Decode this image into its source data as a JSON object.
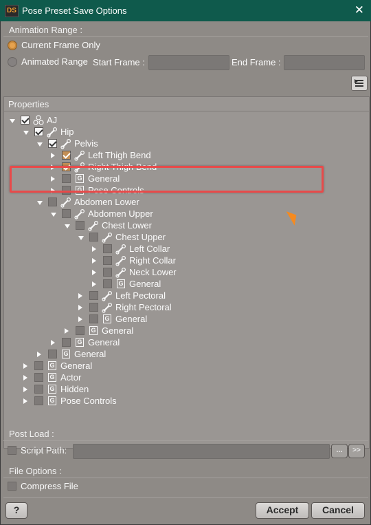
{
  "window": {
    "title": "Pose Preset Save Options",
    "logo": "DS",
    "close": "✕"
  },
  "animation": {
    "section": "Animation Range :",
    "current_frame": "Current Frame Only",
    "animated_range": "Animated Range",
    "start_frame": "Start Frame :",
    "end_frame": "End Frame :"
  },
  "tree": {
    "header": "Properties",
    "rows": [
      {
        "label": "AJ",
        "icon": "figure-icon",
        "checked": "white",
        "arrow": "down"
      },
      {
        "label": "Hip",
        "icon": "bone-icon",
        "checked": "white",
        "arrow": "down"
      },
      {
        "label": "Pelvis",
        "icon": "bone-icon",
        "checked": "white",
        "arrow": "down"
      },
      {
        "label": "Left Thigh Bend",
        "icon": "bone-icon",
        "checked": "orange",
        "arrow": "right"
      },
      {
        "label": "Right Thigh Bend",
        "icon": "bone-icon",
        "checked": "orange",
        "arrow": "right"
      },
      {
        "label": "General",
        "icon": "group-icon",
        "checked": "none",
        "arrow": "right"
      },
      {
        "label": "Pose Controls",
        "icon": "group-icon",
        "checked": "none",
        "arrow": "right"
      },
      {
        "label": "Abdomen Lower",
        "icon": "bone-icon",
        "checked": "none",
        "arrow": "down"
      },
      {
        "label": "Abdomen Upper",
        "icon": "bone-icon",
        "checked": "none",
        "arrow": "down"
      },
      {
        "label": "Chest Lower",
        "icon": "bone-icon",
        "checked": "none",
        "arrow": "down"
      },
      {
        "label": "Chest Upper",
        "icon": "bone-icon",
        "checked": "none",
        "arrow": "down"
      },
      {
        "label": "Left Collar",
        "icon": "bone-icon",
        "checked": "none",
        "arrow": "right"
      },
      {
        "label": "Right Collar",
        "icon": "bone-icon",
        "checked": "none",
        "arrow": "right"
      },
      {
        "label": "Neck Lower",
        "icon": "bone-icon",
        "checked": "none",
        "arrow": "right"
      },
      {
        "label": "General",
        "icon": "group-icon",
        "checked": "none",
        "arrow": "right"
      },
      {
        "label": "Left Pectoral",
        "icon": "bone-icon",
        "checked": "none",
        "arrow": "right"
      },
      {
        "label": "Right Pectoral",
        "icon": "bone-icon",
        "checked": "none",
        "arrow": "right"
      },
      {
        "label": "General",
        "icon": "group-icon",
        "checked": "none",
        "arrow": "right"
      },
      {
        "label": "General",
        "icon": "group-icon",
        "checked": "none",
        "arrow": "right"
      },
      {
        "label": "General",
        "icon": "group-icon",
        "checked": "none",
        "arrow": "right"
      },
      {
        "label": "General",
        "icon": "group-icon",
        "checked": "none",
        "arrow": "right"
      },
      {
        "label": "General",
        "icon": "group-icon",
        "checked": "none",
        "arrow": "right"
      },
      {
        "label": "Actor",
        "icon": "group-icon",
        "checked": "none",
        "arrow": "right"
      },
      {
        "label": "Hidden",
        "icon": "group-icon",
        "checked": "none",
        "arrow": "right"
      },
      {
        "label": "Pose Controls",
        "icon": "group-icon",
        "checked": "none",
        "arrow": "right"
      }
    ]
  },
  "post_load": {
    "section": "Post Load :",
    "script_path": "Script Path:",
    "browse": "...",
    "next": ">>"
  },
  "file_options": {
    "section": "File Options :",
    "compress": "Compress File"
  },
  "footer": {
    "help": "?",
    "accept": "Accept",
    "cancel": "Cancel"
  },
  "colors": {
    "titlebar": "#0f5a4c",
    "panel": "#8e8a86",
    "accent": "#e6a24e",
    "highlight": "#e84a4a"
  }
}
